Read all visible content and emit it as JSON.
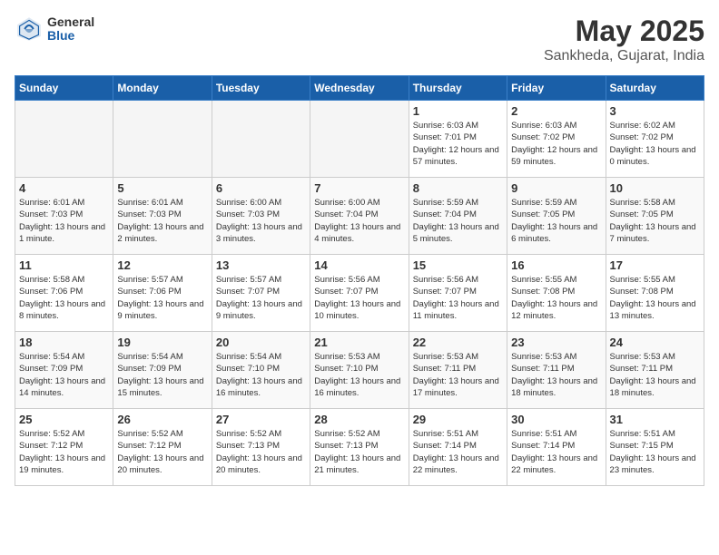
{
  "header": {
    "logo_general": "General",
    "logo_blue": "Blue",
    "month": "May 2025",
    "location": "Sankheda, Gujarat, India"
  },
  "weekdays": [
    "Sunday",
    "Monday",
    "Tuesday",
    "Wednesday",
    "Thursday",
    "Friday",
    "Saturday"
  ],
  "weeks": [
    [
      {
        "day": "",
        "info": ""
      },
      {
        "day": "",
        "info": ""
      },
      {
        "day": "",
        "info": ""
      },
      {
        "day": "",
        "info": ""
      },
      {
        "day": "1",
        "info": "Sunrise: 6:03 AM\nSunset: 7:01 PM\nDaylight: 12 hours and 57 minutes."
      },
      {
        "day": "2",
        "info": "Sunrise: 6:03 AM\nSunset: 7:02 PM\nDaylight: 12 hours and 59 minutes."
      },
      {
        "day": "3",
        "info": "Sunrise: 6:02 AM\nSunset: 7:02 PM\nDaylight: 13 hours and 0 minutes."
      }
    ],
    [
      {
        "day": "4",
        "info": "Sunrise: 6:01 AM\nSunset: 7:03 PM\nDaylight: 13 hours and 1 minute."
      },
      {
        "day": "5",
        "info": "Sunrise: 6:01 AM\nSunset: 7:03 PM\nDaylight: 13 hours and 2 minutes."
      },
      {
        "day": "6",
        "info": "Sunrise: 6:00 AM\nSunset: 7:03 PM\nDaylight: 13 hours and 3 minutes."
      },
      {
        "day": "7",
        "info": "Sunrise: 6:00 AM\nSunset: 7:04 PM\nDaylight: 13 hours and 4 minutes."
      },
      {
        "day": "8",
        "info": "Sunrise: 5:59 AM\nSunset: 7:04 PM\nDaylight: 13 hours and 5 minutes."
      },
      {
        "day": "9",
        "info": "Sunrise: 5:59 AM\nSunset: 7:05 PM\nDaylight: 13 hours and 6 minutes."
      },
      {
        "day": "10",
        "info": "Sunrise: 5:58 AM\nSunset: 7:05 PM\nDaylight: 13 hours and 7 minutes."
      }
    ],
    [
      {
        "day": "11",
        "info": "Sunrise: 5:58 AM\nSunset: 7:06 PM\nDaylight: 13 hours and 8 minutes."
      },
      {
        "day": "12",
        "info": "Sunrise: 5:57 AM\nSunset: 7:06 PM\nDaylight: 13 hours and 9 minutes."
      },
      {
        "day": "13",
        "info": "Sunrise: 5:57 AM\nSunset: 7:07 PM\nDaylight: 13 hours and 9 minutes."
      },
      {
        "day": "14",
        "info": "Sunrise: 5:56 AM\nSunset: 7:07 PM\nDaylight: 13 hours and 10 minutes."
      },
      {
        "day": "15",
        "info": "Sunrise: 5:56 AM\nSunset: 7:07 PM\nDaylight: 13 hours and 11 minutes."
      },
      {
        "day": "16",
        "info": "Sunrise: 5:55 AM\nSunset: 7:08 PM\nDaylight: 13 hours and 12 minutes."
      },
      {
        "day": "17",
        "info": "Sunrise: 5:55 AM\nSunset: 7:08 PM\nDaylight: 13 hours and 13 minutes."
      }
    ],
    [
      {
        "day": "18",
        "info": "Sunrise: 5:54 AM\nSunset: 7:09 PM\nDaylight: 13 hours and 14 minutes."
      },
      {
        "day": "19",
        "info": "Sunrise: 5:54 AM\nSunset: 7:09 PM\nDaylight: 13 hours and 15 minutes."
      },
      {
        "day": "20",
        "info": "Sunrise: 5:54 AM\nSunset: 7:10 PM\nDaylight: 13 hours and 16 minutes."
      },
      {
        "day": "21",
        "info": "Sunrise: 5:53 AM\nSunset: 7:10 PM\nDaylight: 13 hours and 16 minutes."
      },
      {
        "day": "22",
        "info": "Sunrise: 5:53 AM\nSunset: 7:11 PM\nDaylight: 13 hours and 17 minutes."
      },
      {
        "day": "23",
        "info": "Sunrise: 5:53 AM\nSunset: 7:11 PM\nDaylight: 13 hours and 18 minutes."
      },
      {
        "day": "24",
        "info": "Sunrise: 5:53 AM\nSunset: 7:11 PM\nDaylight: 13 hours and 18 minutes."
      }
    ],
    [
      {
        "day": "25",
        "info": "Sunrise: 5:52 AM\nSunset: 7:12 PM\nDaylight: 13 hours and 19 minutes."
      },
      {
        "day": "26",
        "info": "Sunrise: 5:52 AM\nSunset: 7:12 PM\nDaylight: 13 hours and 20 minutes."
      },
      {
        "day": "27",
        "info": "Sunrise: 5:52 AM\nSunset: 7:13 PM\nDaylight: 13 hours and 20 minutes."
      },
      {
        "day": "28",
        "info": "Sunrise: 5:52 AM\nSunset: 7:13 PM\nDaylight: 13 hours and 21 minutes."
      },
      {
        "day": "29",
        "info": "Sunrise: 5:51 AM\nSunset: 7:14 PM\nDaylight: 13 hours and 22 minutes."
      },
      {
        "day": "30",
        "info": "Sunrise: 5:51 AM\nSunset: 7:14 PM\nDaylight: 13 hours and 22 minutes."
      },
      {
        "day": "31",
        "info": "Sunrise: 5:51 AM\nSunset: 7:15 PM\nDaylight: 13 hours and 23 minutes."
      }
    ]
  ]
}
